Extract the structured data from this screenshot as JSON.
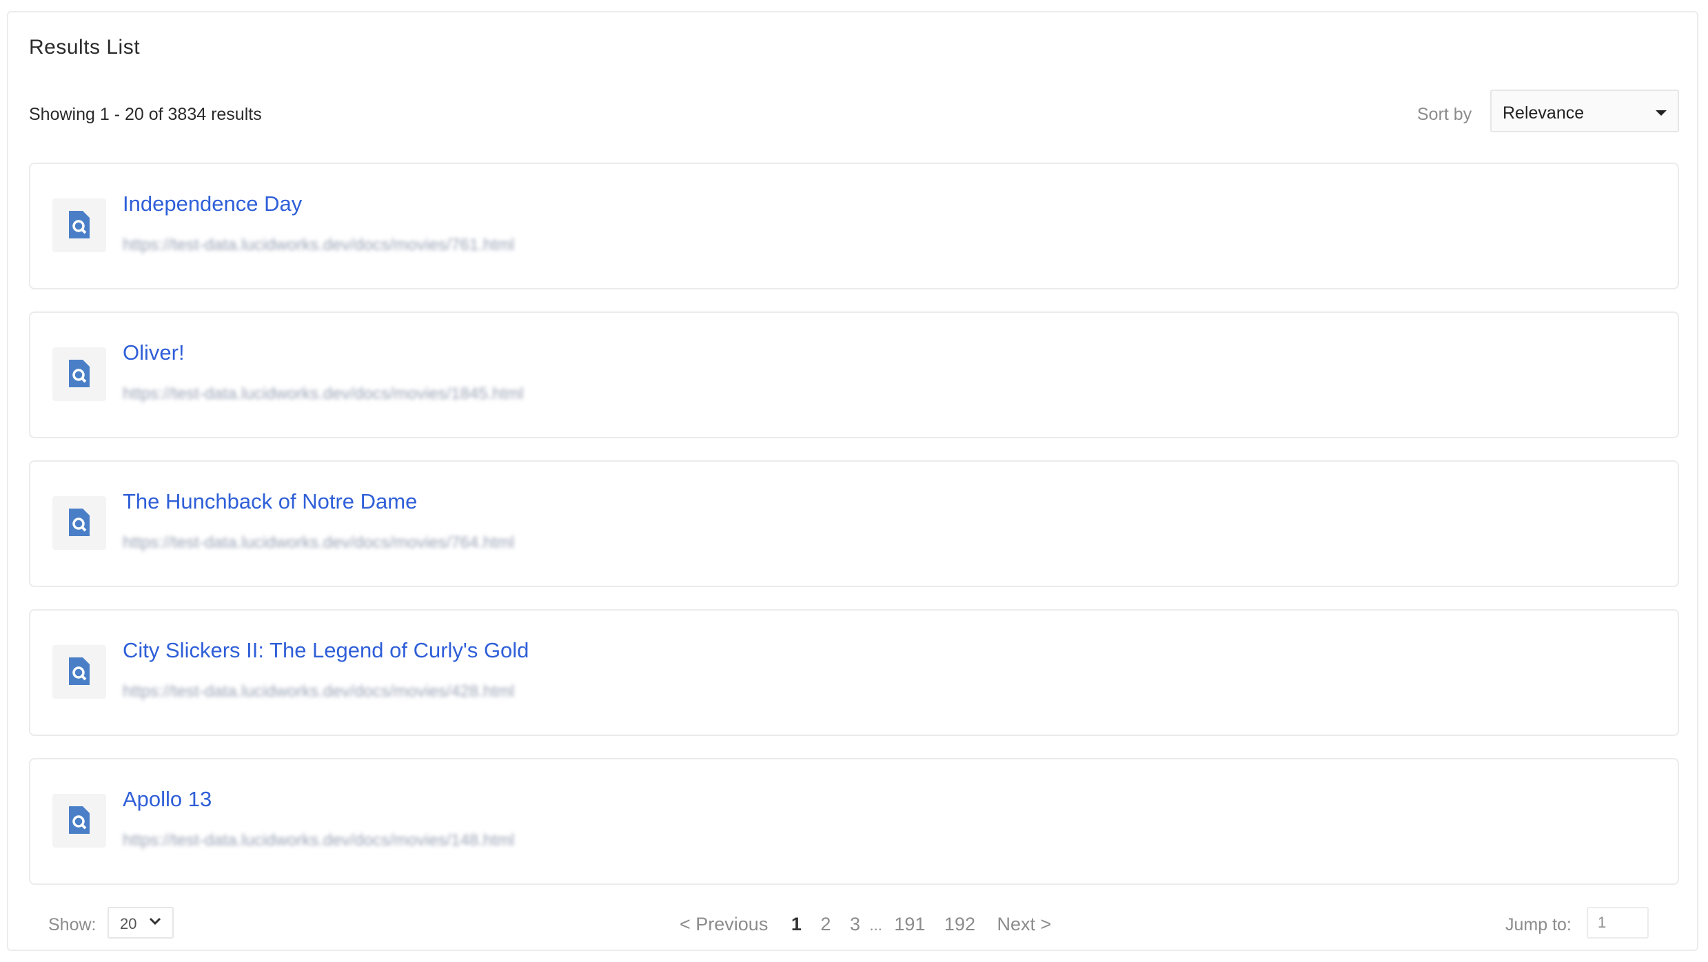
{
  "panel": {
    "title": "Results List",
    "showing": "Showing 1 - 20 of 3834 results"
  },
  "sort": {
    "label": "Sort by",
    "value": "Relevance"
  },
  "results": [
    {
      "title": "Independence Day",
      "url": "https://test-data.lucidworks.dev/docs/movies/761.html"
    },
    {
      "title": "Oliver!",
      "url": "https://test-data.lucidworks.dev/docs/movies/1845.html"
    },
    {
      "title": "The Hunchback of Notre Dame",
      "url": "https://test-data.lucidworks.dev/docs/movies/764.html"
    },
    {
      "title": "City Slickers II: The Legend of Curly's Gold",
      "url": "https://test-data.lucidworks.dev/docs/movies/428.html"
    },
    {
      "title": "Apollo 13",
      "url": "https://test-data.lucidworks.dev/docs/movies/148.html"
    }
  ],
  "footer": {
    "show_label": "Show:",
    "show_value": "20",
    "pagination": {
      "previous": "< Previous",
      "pages": [
        "1",
        "2",
        "3"
      ],
      "ellipsis": "...",
      "last_pages": [
        "191",
        "192"
      ],
      "next": "Next >",
      "current": "1"
    },
    "jump_label": "Jump to:",
    "jump_value": "1"
  },
  "colors": {
    "link": "#2f5fd8",
    "icon": "#4a7fc7",
    "muted": "#8c8c8c"
  },
  "icons": {
    "result": "document-search-icon",
    "sort_caret": "caret-down-icon",
    "show_chevron": "chevron-down-icon"
  }
}
